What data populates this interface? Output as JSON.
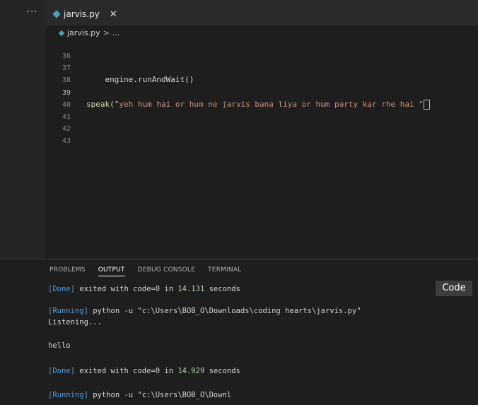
{
  "sidebar": {
    "more_label": "···"
  },
  "tab": {
    "filename": "jarvis.py",
    "close_glyph": "✕"
  },
  "breadcrumb": {
    "file": "jarvis.py",
    "sep": ">",
    "more": "..."
  },
  "editor": {
    "lines": [
      {
        "num": "36",
        "text": ""
      },
      {
        "num": "37",
        "text": "    engine.runAndWait()"
      },
      {
        "num": "38",
        "text": ""
      },
      {
        "num": "39",
        "fn": "speak",
        "open": "(\"",
        "str": "yeh hum hai or hum ne jarvis bana liya or hum party kar rhe hai \""
      },
      {
        "num": "40",
        "text": ""
      },
      {
        "num": "41",
        "text": ""
      },
      {
        "num": "42",
        "text": ""
      },
      {
        "num": "43",
        "text": ""
      }
    ]
  },
  "panel": {
    "tabs": [
      "PROBLEMS",
      "OUTPUT",
      "DEBUG CONSOLE",
      "TERMINAL"
    ],
    "active_tab": "OUTPUT",
    "language": "Code",
    "output": {
      "line1_tag": "[Done]",
      "line1_text": " exited with code=0 in ",
      "line1_time": "14.131",
      "line1_unit": " seconds",
      "line2_tag": "[Running]",
      "line2_text": " python -u \"c:\\Users\\BOB_O\\Downloads\\coding hearts\\jarvis.py\"",
      "line3": "Listening...",
      "line4": "hello",
      "line5_tag": "[Done]",
      "line5_text": " exited with code=0 in ",
      "line5_time": "14.929",
      "line5_unit": " seconds",
      "line6_tag": "[Running]",
      "line6_text": " python -u \"c:\\Users\\BOB_O\\Downl"
    }
  }
}
